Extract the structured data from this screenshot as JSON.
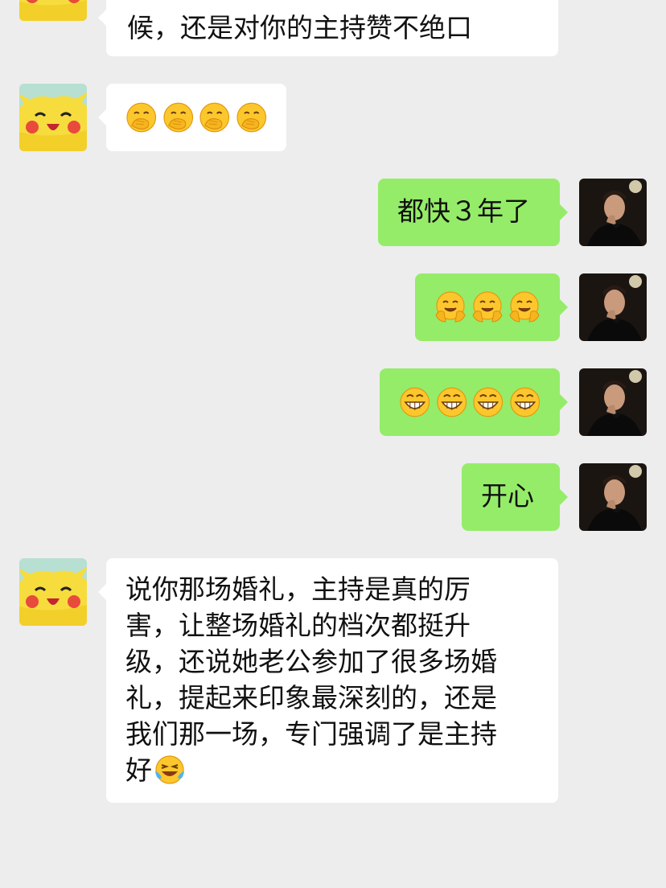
{
  "messages": [
    {
      "side": "in",
      "text": "候，还是对你的主持赞不绝口"
    },
    {
      "side": "in",
      "emoji": "hand-over-mouth-emoji",
      "count": 4
    },
    {
      "side": "out",
      "text": "都快３年了"
    },
    {
      "side": "out",
      "emoji": "hugging-face-emoji",
      "count": 3
    },
    {
      "side": "out",
      "emoji": "grinning-teeth-emoji",
      "count": 4
    },
    {
      "side": "out",
      "text": "开心"
    },
    {
      "side": "in",
      "lines": [
        "说你那场婚礼，主持是真的厉",
        "害，让整场婚礼的档次都挺升",
        "级，还说她老公参加了很多场婚",
        "礼，提起来印象最深刻的，还是",
        "我们那一场，专门强调了是主持",
        "好"
      ],
      "trailing_emoji": "laughing-tears-emoji"
    }
  ],
  "colors": {
    "background": "#ededed",
    "incoming": "#ffffff",
    "outgoing": "#95ec69"
  }
}
